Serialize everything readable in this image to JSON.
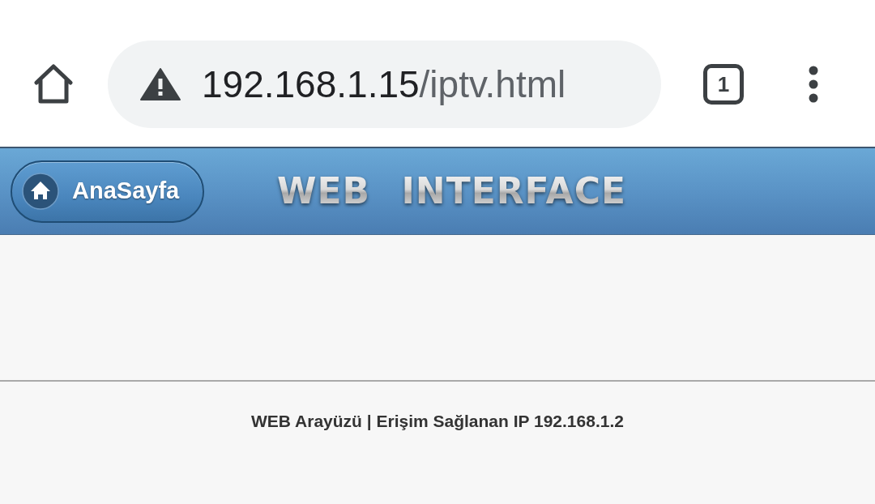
{
  "browser": {
    "url_host": "192.168.1.15",
    "url_path": "/iptv.html",
    "tab_count": "1"
  },
  "header": {
    "home_button": {
      "label": "AnaSayfa"
    },
    "logo_text": "WEB INTERFACE"
  },
  "footer": {
    "text": "WEB Arayüzü | Erişim Sağlanan IP 192.168.1.2"
  }
}
